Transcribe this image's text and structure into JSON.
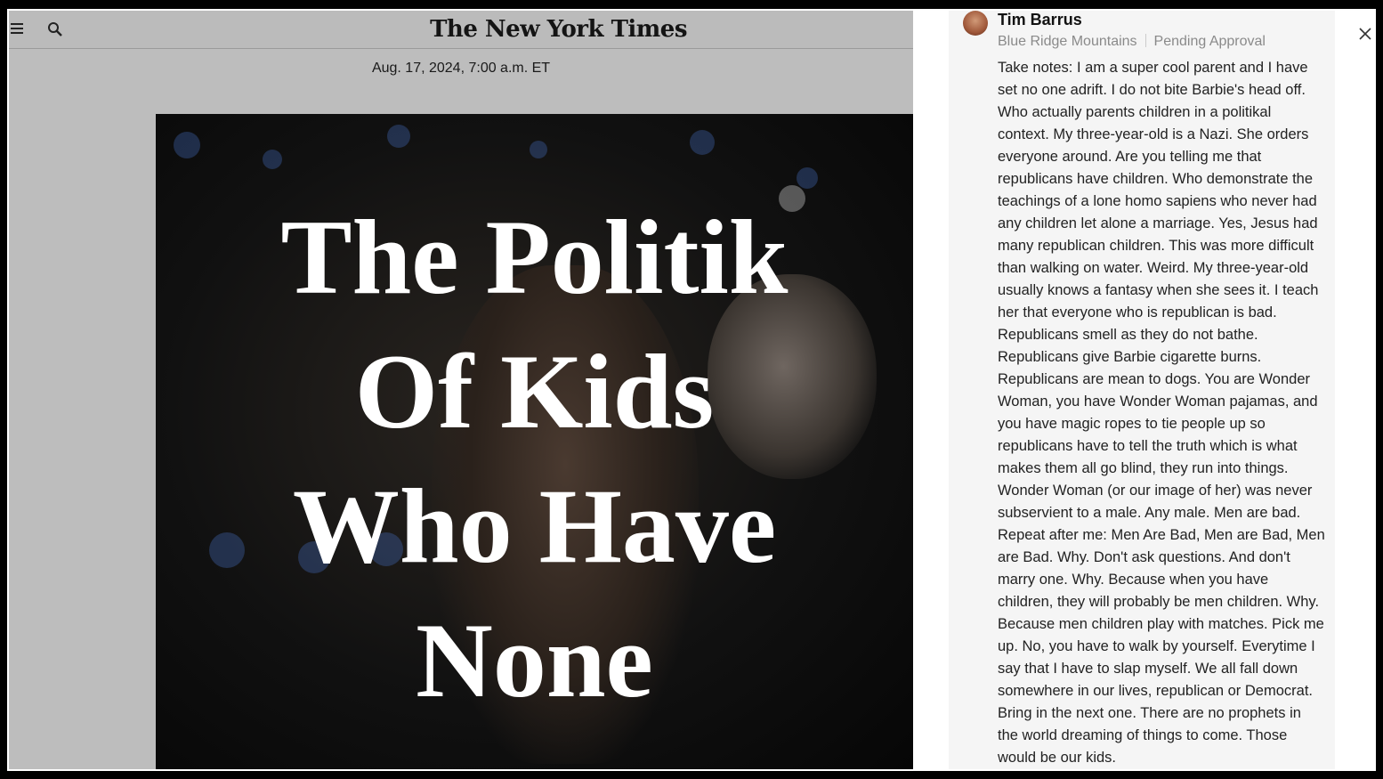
{
  "header": {
    "masthead": "The New York Times",
    "menu_icon": "hamburger-menu-icon",
    "search_icon": "search-icon"
  },
  "article": {
    "dateline": "Aug. 17, 2024, 7:00 a.m. ET",
    "hero_title_lines": [
      "The Politik",
      "Of Kids",
      "Who Have",
      "None"
    ]
  },
  "comment": {
    "author": "Tim Barrus",
    "location": "Blue Ridge Mountains",
    "status": "Pending Approval",
    "body": "Take notes: I am a super cool parent and I have set no one adrift. I do not bite Barbie's head off. Who actually parents children in a politikal context. My three-year-old is a Nazi. She orders everyone around. Are you telling me that republicans have children. Who demonstrate the teachings of a lone homo sapiens who never had any children let alone a marriage. Yes, Jesus had many republican children. This was more difficult than walking on water. Weird. My three-year-old usually knows a fantasy when she sees it. I teach her that everyone who is republican is bad. Republicans smell as they do not bathe. Republicans give Barbie cigarette burns. Republicans are mean to dogs. You are Wonder Woman, you have Wonder Woman pajamas, and you have magic ropes to tie people up so republicans have to tell the truth which is what makes them all go blind, they run into things. Wonder Woman (or our image of her) was never subservient to a male. Any male. Men are bad. Repeat after me: Men Are Bad, Men are Bad, Men are Bad. Why. Don't ask questions. And don't marry one. Why. Because when you have children, they will probably be men children. Why. Because men children play with matches. Pick me up. No, you have to walk by yourself. Everytime I say that I have to slap myself. We all fall down somewhere in our lives, republican or Democrat. Bring in the next one. There are no prophets in the world dreaming of things to come. Those would be our kids."
  },
  "panel": {
    "close_icon": "close-icon"
  }
}
